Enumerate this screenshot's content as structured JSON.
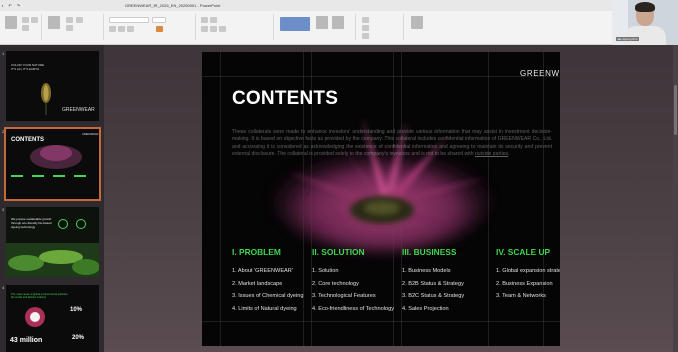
{
  "window": {
    "title": "GREENWEAR_IR_2025_EN_20250001 - PowerPoint"
  },
  "webcam": {
    "participant_name": "Jae-Hyung Kim"
  },
  "thumbnails": [
    {
      "number": "1",
      "heading": "COLOR YOUR NATURE\nIT'S ALL IT'S EARTH",
      "brand": "GREENWEAR"
    },
    {
      "number": "2",
      "title": "CONTENTS",
      "brand": "GREENWEAR"
    },
    {
      "number": "3",
      "heading": "We pursue sustainable growth\nthrough eco-friendly bio-based\ndyeing technology"
    },
    {
      "number": "4",
      "heading": "The main cause of global environmental pollution:\nthe textile and fashion industry",
      "stat_big": "43 million",
      "stat_1": "10%",
      "stat_2": "20%"
    }
  ],
  "slide": {
    "brand": "GREENWEAR",
    "title": "CONTENTS",
    "paragraph": "These collaterals were made to enhance investors' understanding and provide various information that may assist in investment decision-making. It is based on objective facts as provided by the company. This collateral includes confidential information of GREENWEAR Co., Ltd. and accessing it is considered as acknowledging the existence of confidential information and agreeing to maintain its security and prevent external disclosure. The collateral is provided solely to the company's investors and is not to be shared with",
    "paragraph_link": "outside parties",
    "sections": [
      {
        "heading": "I. PROBLEM",
        "items": [
          "1. About 'GREENWEAR'",
          "2. Market landscape",
          "3. Issues of Chemical dyeing",
          "4. Limits of Natural dyeing"
        ]
      },
      {
        "heading": "II. SOLUTION",
        "items": [
          "1. Solution",
          "2. Core technology",
          "3. Technological Features",
          "4. Eco-friendliness of Technology"
        ]
      },
      {
        "heading": "III. BUSINESS",
        "items": [
          "1. Business Models",
          "2. B2B Status & Strategy",
          "3. B2C Status & Strategy",
          "4. Sales Projection"
        ]
      },
      {
        "heading": "IV. SCALE UP",
        "items": [
          "1. Global expansion strategies",
          "2. Business Expansion",
          "3. Team & Networks"
        ]
      }
    ]
  },
  "colors": {
    "accent_green": "#3fd650",
    "slide_bg": "#050505",
    "selection": "#c46a3a"
  }
}
